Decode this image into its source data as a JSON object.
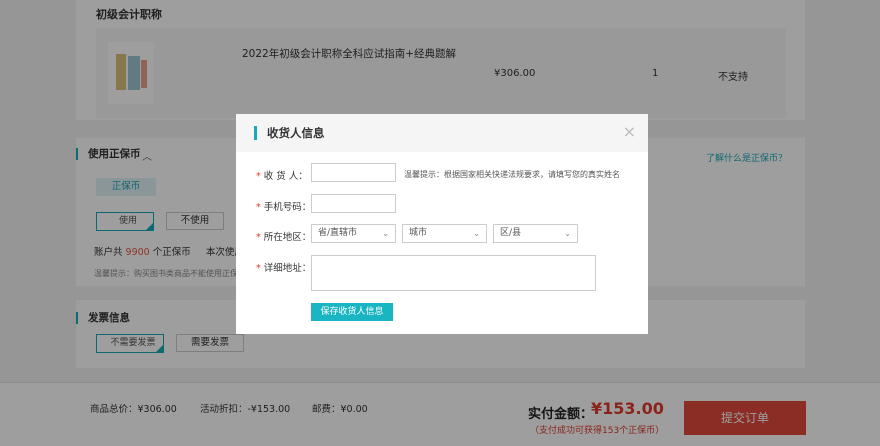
{
  "product_section": {
    "title": "初级会计职称",
    "product": {
      "name": "2022年初级会计职称全科应试指南+经典题解",
      "price": "¥306.00",
      "quantity": "1",
      "support": "不支持"
    }
  },
  "coin_section": {
    "title": "使用正保币",
    "link": "了解什么是正保币？",
    "tag": "正保币",
    "use_label": "使用",
    "nouse_label": "不使用",
    "balance_prefix": "账户共",
    "balance_value": "9900",
    "balance_suffix": "个正保币",
    "this_use": "本次使用",
    "hint": "温馨提示：购买图书类商品不能使用正保币"
  },
  "invoice_section": {
    "title": "发票信息",
    "no_invoice": "不需要发票",
    "need_invoice": "需要发票"
  },
  "footer": {
    "total": "商品总价：¥306.00",
    "discount": "活动折扣：-¥153.00",
    "shipping": "邮费：¥0.00",
    "pay_label": "实付金额：",
    "pay_amount": "¥153.00",
    "earn": "（支付成功可获得153个正保币）",
    "submit": "提交订单"
  },
  "modal": {
    "title": "收货人信息",
    "close_symbol": "×",
    "fields": {
      "name_label": "收 货 人：",
      "name_tip": "温馨提示：根据国家相关快递法规要求，请填写您的真实姓名",
      "phone_label": "手机号码：",
      "region_label": "所在地区：",
      "province": "省/直辖市",
      "city": "城市",
      "district": "区/县",
      "address_label": "详细地址："
    },
    "required_mark": "*",
    "save_label": "保存收货人信息"
  },
  "colors": {
    "accent": "#1aa8b8",
    "price_red": "#e0392b",
    "submit_bg": "#e04a3a"
  }
}
